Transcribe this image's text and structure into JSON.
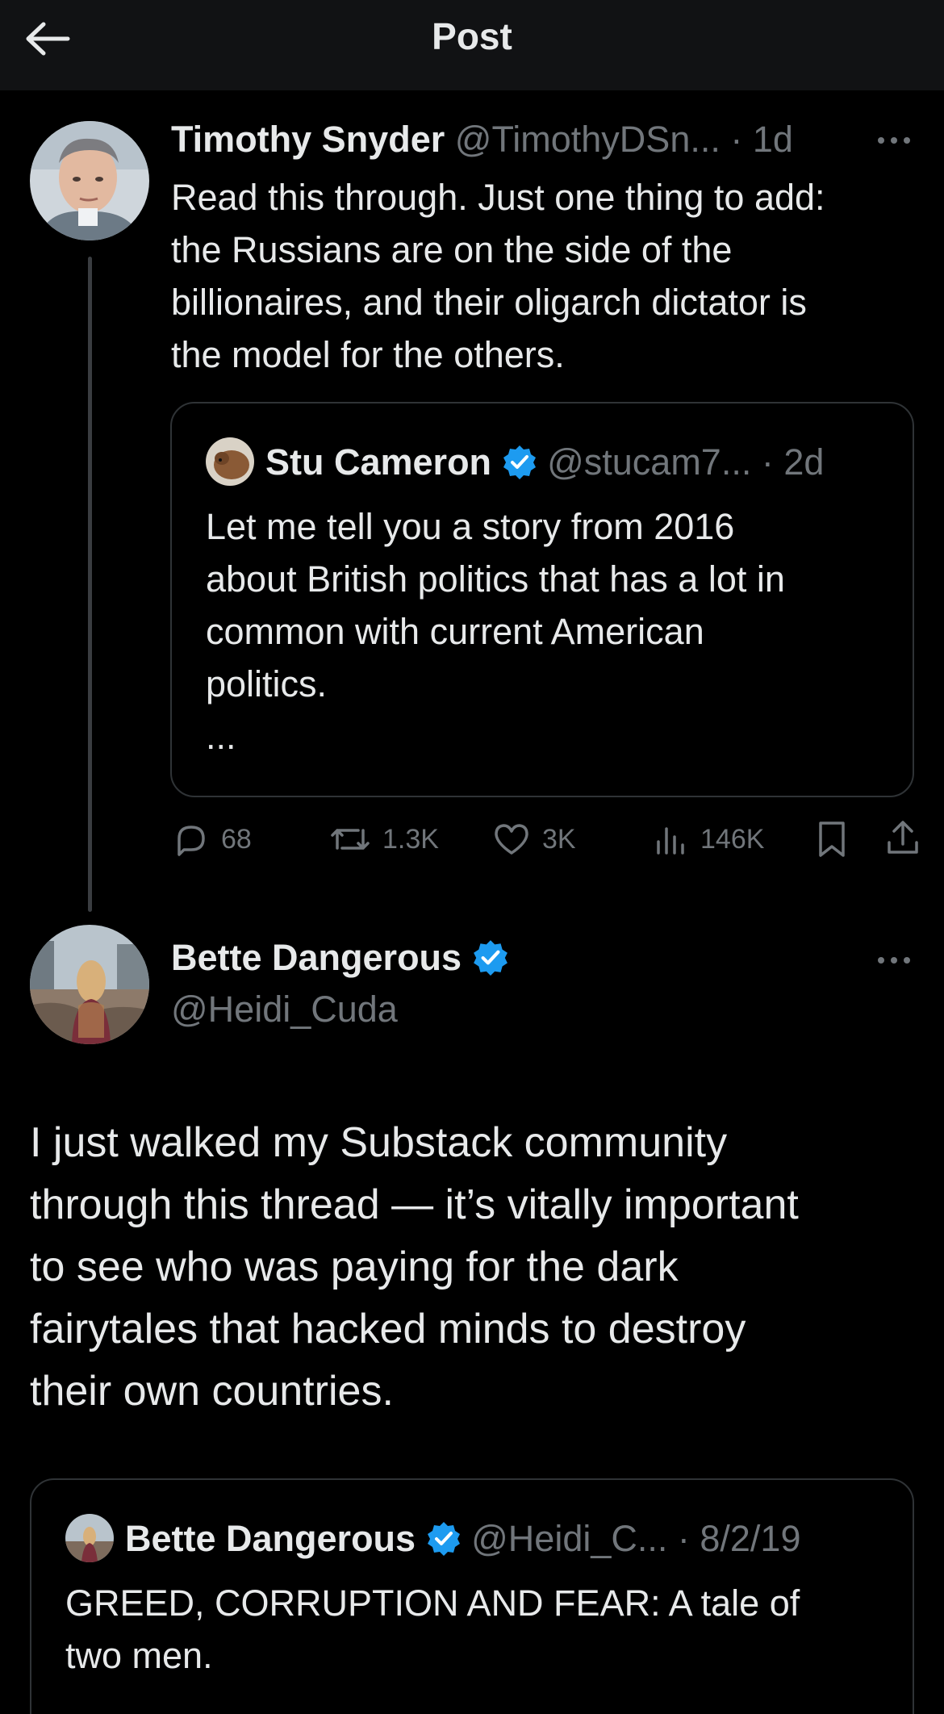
{
  "header": {
    "title": "Post"
  },
  "main_post": {
    "author_name": "Timothy Snyder",
    "handle": "@TimothyDSn...",
    "time": "· 1d",
    "text": "Read this through. Just one thing to add:\nthe Russians are on the side of the\nbillionaires, and their oligarch  dictator is\nthe model for the others.",
    "quote": {
      "author_name": "Stu Cameron",
      "handle": "@stucam7...",
      "time": "· 2d",
      "text": "Let me tell you a story from 2016\nabout British politics that has a lot in\ncommon with current American\npolitics.\n...",
      "verified": true
    },
    "stats": {
      "replies": "68",
      "reposts": "1.3K",
      "likes": "3K",
      "views": "146K"
    }
  },
  "reply_post": {
    "author_name": "Bette Dangerous",
    "handle": "@Heidi_Cuda",
    "verified": true,
    "text": "I just walked my Substack community\nthrough this thread — it’s vitally important\nto see who was paying for the dark\nfairytales that hacked minds to destroy\ntheir own countries.",
    "quote": {
      "author_name": "Bette Dangerous",
      "handle": "@Heidi_C...",
      "time": "· 8/2/19",
      "text": "GREED, CORRUPTION AND FEAR: A tale of\ntwo men.",
      "verified": true
    }
  },
  "colors": {
    "background": "#000000",
    "header": "#111214",
    "text": "#e7e9ea",
    "muted": "#71767b",
    "border": "#2f3336",
    "verified": "#1d9bf0"
  },
  "icons": [
    "back-arrow-icon",
    "more-icon",
    "verified-icon",
    "reply-icon",
    "repost-icon",
    "like-icon",
    "views-icon",
    "bookmark-icon",
    "share-icon"
  ]
}
